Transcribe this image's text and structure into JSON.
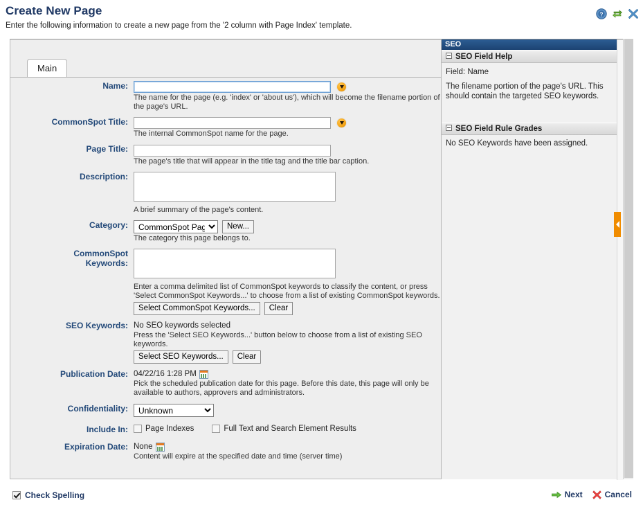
{
  "header": {
    "title": "Create New Page",
    "subtitle": "Enter the following information to create a new page from the '2 column with Page Index' template.",
    "icons": [
      {
        "name": "help-icon",
        "glyph": "?"
      },
      {
        "name": "refresh-icon",
        "glyph": "⇄"
      },
      {
        "name": "close-icon",
        "glyph": "✕"
      }
    ]
  },
  "tabs": [
    {
      "label": "Main",
      "active": true
    }
  ],
  "form": {
    "name": {
      "label": "Name:",
      "value": "",
      "hint": "The name for the page (e.g. 'index' or 'about us'), which will become the filename portion of the page's URL.",
      "required": true,
      "focused": true
    },
    "commonspot_title": {
      "label": "CommonSpot Title:",
      "value": "",
      "hint": "The internal CommonSpot name for the page.",
      "required": true
    },
    "page_title": {
      "label": "Page Title:",
      "value": "",
      "hint": "The page's title that will appear in the title tag and the title bar caption."
    },
    "description": {
      "label": "Description:",
      "value": "",
      "hint": "A brief summary of the page's content."
    },
    "category": {
      "label": "Category:",
      "selected": "CommonSpot Pages",
      "options": [
        "CommonSpot Pages"
      ],
      "new_button": "New...",
      "hint": "The category this page belongs to."
    },
    "commonspot_keywords": {
      "label": "CommonSpot Keywords:",
      "label_line1": "CommonSpot",
      "label_line2": "Keywords:",
      "value": "",
      "hint": "Enter a comma delimited list of CommonSpot keywords to classify the content, or press 'Select CommonSpot Keywords...' to choose from a list of existing CommonSpot keywords.",
      "select_button": "Select CommonSpot Keywords...",
      "clear_button": "Clear"
    },
    "seo_keywords": {
      "label": "SEO Keywords:",
      "status": "No SEO keywords selected",
      "hint": "Press the 'Select SEO Keywords...' button below to choose from a list of existing SEO keywords.",
      "select_button": "Select SEO Keywords...",
      "clear_button": "Clear"
    },
    "publication_date": {
      "label": "Publication Date:",
      "value": "04/22/16 1:28 PM",
      "hint": "Pick the scheduled publication date for this page. Before this date, this page will only be available to authors, approvers and administrators."
    },
    "confidentiality": {
      "label": "Confidentiality:",
      "selected": "Unknown",
      "options": [
        "Unknown"
      ]
    },
    "include_in": {
      "label": "Include In:",
      "options": [
        {
          "label": "Page Indexes",
          "checked": false
        },
        {
          "label": "Full Text and Search Element Results",
          "checked": false
        }
      ]
    },
    "expiration_date": {
      "label": "Expiration Date:",
      "value": "None",
      "hint": "Content will expire at the specified date and time (server time)"
    }
  },
  "seo_panel": {
    "title": "SEO",
    "sections": [
      {
        "heading": "SEO Field Help",
        "field_line": "Field: Name",
        "body": "The filename portion of the page's URL. This should contain the targeted SEO keywords."
      },
      {
        "heading": "SEO Field Rule Grades",
        "body": "No SEO Keywords have been assigned."
      }
    ]
  },
  "footer": {
    "check_spelling": {
      "label": "Check Spelling",
      "checked": true
    },
    "next": "Next",
    "cancel": "Cancel"
  },
  "colors": {
    "title_blue": "#1f3864",
    "label_blue": "#234979",
    "required_orange": "#f7a81b",
    "seo_header": "#1d4372",
    "handle_orange": "#f08c00",
    "cancel_red": "#e03b3b",
    "next_green": "#4aa02c"
  }
}
